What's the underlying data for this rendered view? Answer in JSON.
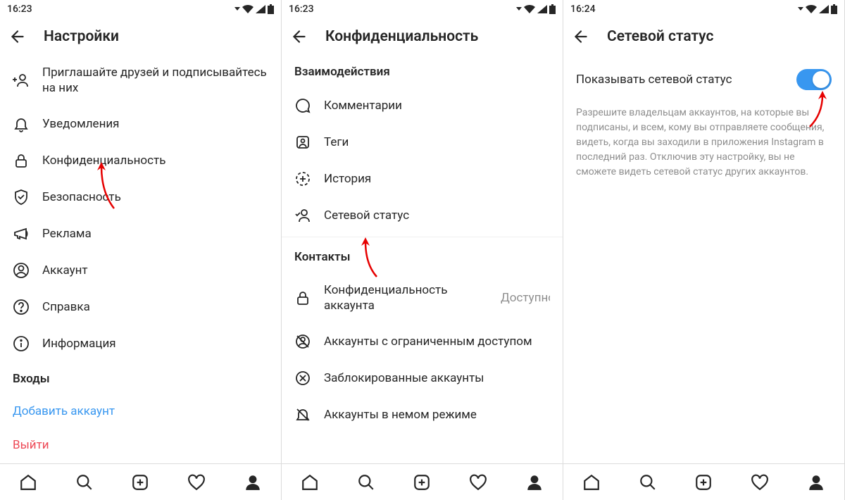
{
  "screen1": {
    "time": "16:23",
    "title": "Настройки",
    "items": [
      {
        "label": "Приглашайте друзей и подписывайтесь на них"
      },
      {
        "label": "Уведомления"
      },
      {
        "label": "Конфиденциальность"
      },
      {
        "label": "Безопасность"
      },
      {
        "label": "Реклама"
      },
      {
        "label": "Аккаунт"
      },
      {
        "label": "Справка"
      },
      {
        "label": "Информация"
      }
    ],
    "section_logins": "Входы",
    "add_account": "Добавить аккаунт",
    "logout": "Выйти"
  },
  "screen2": {
    "time": "16:23",
    "title": "Конфиденциальность",
    "section_interactions": "Взаимодействия",
    "items_a": [
      {
        "label": "Комментарии"
      },
      {
        "label": "Теги"
      },
      {
        "label": "История"
      },
      {
        "label": "Сетевой статус"
      }
    ],
    "section_contacts": "Контакты",
    "items_b": [
      {
        "label": "Конфиденциальность аккаунта",
        "trailing": "Доступно"
      },
      {
        "label": "Аккаунты с ограниченным доступом"
      },
      {
        "label": "Заблокированные аккаунты"
      },
      {
        "label": "Аккаунты в немом режиме"
      }
    ]
  },
  "screen3": {
    "time": "16:24",
    "title": "Сетевой статус",
    "toggle_label": "Показывать сетевой статус",
    "description": "Разрешите владельцам аккаунтов, на которые вы подписаны, и всем, кому вы отправляете сообщения, видеть, когда вы заходили в приложения Instagram в последний раз. Отключив эту настройку, вы не сможете видеть сетевой статус других аккаунтов."
  }
}
